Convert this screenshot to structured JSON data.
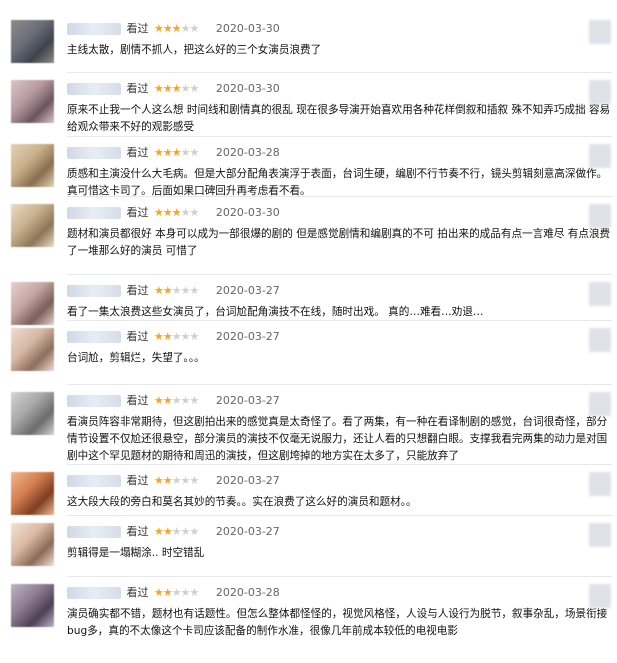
{
  "colors": {
    "star_on": "#f6a623",
    "star_off": "#d0d0d0",
    "date": "#666666"
  },
  "reviews": [
    {
      "watched": "看过",
      "rating": 3,
      "date": "2020-03-30",
      "text": "主线太散，剧情不抓人，把这么好的三个女演员浪费了"
    },
    {
      "watched": "看过",
      "rating": 3,
      "date": "2020-03-30",
      "text": "原来不止我一个人这么想 时间线和剧情真的很乱 现在很多导演开始喜欢用各种花样倒叙和插叙 殊不知弄巧成拙 容易给观众带来不好的观影感受"
    },
    {
      "watched": "看过",
      "rating": 3,
      "date": "2020-03-28",
      "text": "质感和主演没什么大毛病。但是大部分配角表演浮于表面，台词生硬，编剧不行节奏不行，镜头剪辑刻意高深做作。真可惜这卡司了。后面如果口碑回升再考虑看不看。"
    },
    {
      "watched": "看过",
      "rating": 3,
      "date": "2020-03-30",
      "text": "题材和演员都很好 本身可以成为一部很爆的剧的 但是感觉剧情和编剧真的不可 拍出来的成品有点一言难尽 有点浪费了一堆那么好的演员 可惜了"
    },
    {
      "watched": "看过",
      "rating": 2,
      "date": "2020-03-27",
      "text": "看了一集太浪费这些女演员了，台词尬配角演技不在线，随时出戏。 真的…难看…劝退…"
    },
    {
      "watched": "看过",
      "rating": 2,
      "date": "2020-03-27",
      "text": "台词尬，剪辑烂，失望了。。。"
    },
    {
      "watched": "看过",
      "rating": 2,
      "date": "2020-03-27",
      "text": "看演员阵容非常期待，但这剧拍出来的感觉真是太奇怪了。看了两集，有一种在看译制剧的感觉，台词很奇怪，部分情节设置不仅尬还很悬空，部分演员的演技不仅毫无说服力，还让人看的只想翻白眼。支撑我看完两集的动力是对国剧中这个罕见题材的期待和周迅的演技，但这剧垮掉的地方实在太多了，只能放弃了"
    },
    {
      "watched": "看过",
      "rating": 2,
      "date": "2020-03-27",
      "text": "这大段大段的旁白和莫名其妙的节奏。。实在浪费了这么好的演员和题材。。"
    },
    {
      "watched": "看过",
      "rating": 2,
      "date": "2020-03-27",
      "text": "剪辑得是一塌糊涂.. 时空错乱"
    },
    {
      "watched": "看过",
      "rating": 2,
      "date": "2020-03-28",
      "text": "演员确实都不错，题材也有话题性。但怎么整体都怪怪的，视觉风格怪，人设与人设行为脱节，叙事杂乱，场景衔接bug多，真的不太像这个卡司应该配备的制作水准，很像几年前成本较低的电视电影"
    }
  ]
}
